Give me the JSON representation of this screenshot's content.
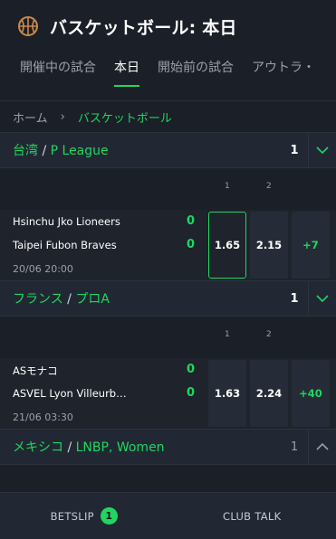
{
  "header": {
    "title": "バスケットボール: 本日"
  },
  "tabs": [
    {
      "label": "開催中の試合",
      "active": false
    },
    {
      "label": "本日",
      "active": true
    },
    {
      "label": "開始前の試合",
      "active": false
    },
    {
      "label": "アウトラ・",
      "active": false
    }
  ],
  "breadcrumb": {
    "home": "ホーム",
    "separator": "›",
    "current": "バスケットボール"
  },
  "leagues": [
    {
      "country": "台湾",
      "slash": " / ",
      "name": "P League",
      "count": "1",
      "columns": [
        "1",
        "2"
      ],
      "event": {
        "home": "Hsinchu Jko Lioneers",
        "away": "Taipei Fubon Braves",
        "home_score": "0",
        "away_score": "0",
        "time": "20/06 20:00",
        "odds": [
          "1.65",
          "2.15"
        ],
        "more": "+7"
      }
    },
    {
      "country": "フランス",
      "slash": " / ",
      "name": "プロA",
      "count": "1",
      "columns": [
        "1",
        "2"
      ],
      "event": {
        "home": "ASモナコ",
        "away": "ASVEL Lyon Villeurb…",
        "home_score": "0",
        "away_score": "0",
        "time": "21/06 03:30",
        "odds": [
          "1.63",
          "2.24"
        ],
        "more": "+40"
      }
    },
    {
      "country": "メキシコ",
      "slash": " / ",
      "name": "LNBP, Women",
      "count": "1"
    }
  ],
  "bottom": {
    "betslip": "BETSLIP",
    "betslip_count": "1",
    "club_talk": "CLUB TALK"
  },
  "colors": {
    "accent": "#1fd660",
    "background": "#1b1f27",
    "panel": "#222833"
  }
}
